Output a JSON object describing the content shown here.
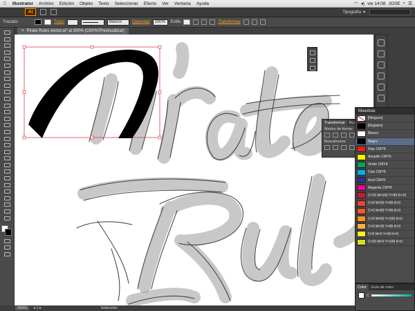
{
  "menubar": {
    "apple": "",
    "app": "Illustrator",
    "items": [
      "Archivo",
      "Edición",
      "Objeto",
      "Texto",
      "Seleccionar",
      "Efecto",
      "Ver",
      "Ventana",
      "Ayuda"
    ],
    "clock": "vie 14:08",
    "user": "JOSE"
  },
  "appbar": {
    "logo": "Ai",
    "workspace": "Tipografía"
  },
  "control": {
    "selection_label": "Trazado",
    "stroke_label": "Trazo",
    "stroke_profile": "Básico",
    "opacity_label": "Opacidad",
    "opacity_value": "100%",
    "style_label": "Estilo",
    "transform_label": "Transformar"
  },
  "document": {
    "tab_title": "Pirate Rules vector.ai* al 300% (CMYK/Previsualizar)",
    "close": "×"
  },
  "transform_panel": {
    "tabs": [
      "Transformar",
      "Buscatrazos"
    ],
    "shape_modes_label": "Modos de forma:",
    "pathfinders_label": "Buscatrazos:"
  },
  "swatches_panel": {
    "title": "Muestras",
    "items": [
      {
        "name": "[Ninguno]",
        "color": "#ffffff",
        "none": true
      },
      {
        "name": "[Registro]",
        "color": "#000000"
      },
      {
        "name": "Blanco",
        "color": "#ffffff"
      },
      {
        "name": "Negro",
        "color": "#000000",
        "selected": true
      },
      {
        "name": "Rojo CMYK",
        "color": "#e2231a"
      },
      {
        "name": "Amarillo CMYK",
        "color": "#ffec00"
      },
      {
        "name": "Verde CMYK",
        "color": "#00a650"
      },
      {
        "name": "Cian CMYK",
        "color": "#00aeef"
      },
      {
        "name": "Azul CMYK",
        "color": "#2e3192"
      },
      {
        "name": "Magenta CMYK",
        "color": "#ec008c"
      },
      {
        "name": "C=15 M=100 Y=90 K=10",
        "color": "#be1e2d"
      },
      {
        "name": "C=0 M=90 Y=85 K=0",
        "color": "#ef4136"
      },
      {
        "name": "C=0 M=80 Y=95 K=0",
        "color": "#f15a29"
      },
      {
        "name": "C=0 M=50 Y=100 K=0",
        "color": "#f7941d"
      },
      {
        "name": "C=0 M=35 Y=85 K=0",
        "color": "#fbb040"
      },
      {
        "name": "C=5 M=0 Y=90 K=0",
        "color": "#f9ed32"
      },
      {
        "name": "C=20 M=0 Y=100 K=0",
        "color": "#d7df23"
      }
    ]
  },
  "color_panel": {
    "tabs": [
      "Color",
      "Guía de color"
    ],
    "channel": "C"
  },
  "status": {
    "zoom": "300%",
    "tool": "Selección"
  },
  "artwork": {
    "ink_color": "#000000",
    "sketch_color": "#9a9a9a",
    "selection_color": "#e03a4a"
  }
}
